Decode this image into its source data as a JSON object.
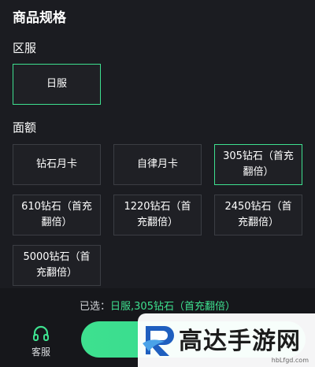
{
  "title": "商品规格",
  "region": {
    "label": "区服",
    "options": [
      "日服"
    ]
  },
  "denomination": {
    "label": "面额",
    "options": [
      "钻石月卡",
      "自律月卡",
      "305钻石（首充翻倍）",
      "610钻石（首充翻倍）",
      "1220钻石（首充翻倍）",
      "2450钻石（首充翻倍）",
      "5000钻石（首充翻倍）"
    ]
  },
  "summary": {
    "prefix": "已选：",
    "value": "日服,305钻石（首充翻倍）"
  },
  "footer": {
    "service_label": "客服"
  },
  "watermark": {
    "text": "高达手游网",
    "url": "hbLfgd.com"
  },
  "colors": {
    "accent": "#3ee08f",
    "background": "#1b1c21",
    "border": "#3b3d43"
  }
}
